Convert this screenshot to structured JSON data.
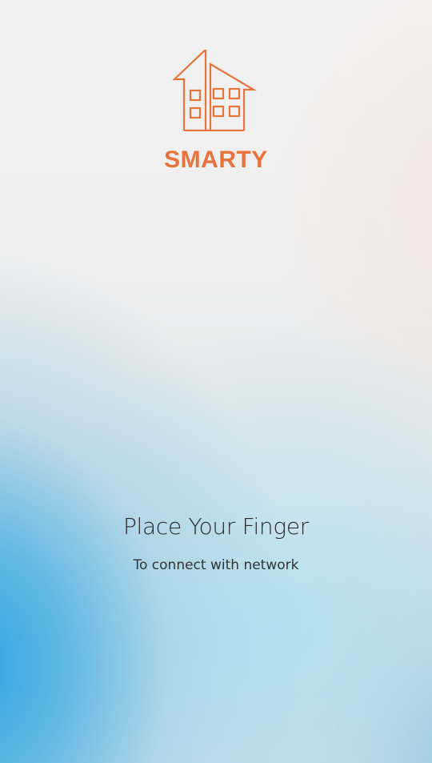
{
  "app": {
    "brand_name": "SMARTY",
    "logo_icon": "house-buildings-icon",
    "accent_color": "#e8743c"
  },
  "prompt": {
    "headline": "Place Your Finger",
    "subline": "To connect with network"
  }
}
